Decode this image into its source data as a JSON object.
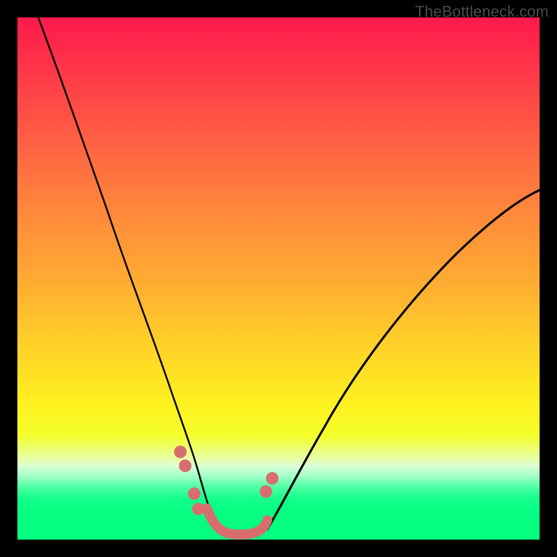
{
  "watermark": "TheBottleneck.com",
  "chart_data": {
    "type": "line",
    "title": "",
    "xlabel": "",
    "ylabel": "",
    "xlim": [
      0,
      100
    ],
    "ylim": [
      0,
      100
    ],
    "grid": false,
    "legend": false,
    "series": [
      {
        "name": "bottleneck-curve",
        "x": [
          4,
          8,
          12,
          16,
          20,
          24,
          28,
          31,
          33,
          36,
          38,
          41,
          46,
          52,
          58,
          66,
          76,
          88,
          100
        ],
        "y": [
          100,
          88,
          77,
          66,
          55,
          44,
          32,
          21,
          13,
          6,
          2,
          0,
          0,
          6,
          15,
          28,
          43,
          57,
          67
        ]
      }
    ],
    "annotations": {
      "trough_range_x": [
        36,
        46
      ],
      "marker_points": [
        {
          "x": 31.2,
          "y": 16.8
        },
        {
          "x": 32.1,
          "y": 14.1
        },
        {
          "x": 33.8,
          "y": 8.8
        },
        {
          "x": 34.7,
          "y": 5.9
        },
        {
          "x": 47.6,
          "y": 9.2
        },
        {
          "x": 48.8,
          "y": 11.7
        }
      ]
    },
    "background_gradient": {
      "top": "#ff1a4b",
      "mid": "#fff11f",
      "bottom": "#03ff7d"
    }
  }
}
